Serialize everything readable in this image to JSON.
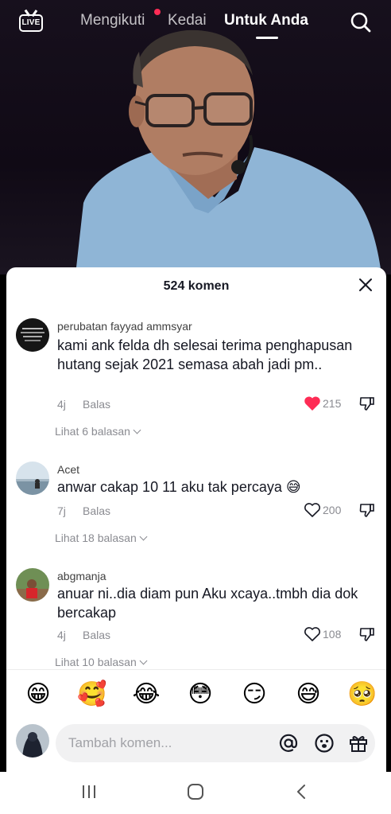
{
  "topnav": {
    "live_label": "LIVE",
    "tabs": [
      {
        "label": "Mengikuti"
      },
      {
        "label": "Kedai"
      },
      {
        "label": "Untuk Anda"
      }
    ]
  },
  "comments_sheet": {
    "title": "524 komen",
    "comments": [
      {
        "username": "perubatan fayyad ammsyar",
        "text": "kami ank felda dh selesai terima penghapusan hutang sejak 2021 semasa abah jadi pm..",
        "time": "4j",
        "reply_label": "Balas",
        "likes": "215",
        "liked": true,
        "view_replies": "Lihat 6 balasan"
      },
      {
        "username": "Acet",
        "text": "anwar cakap 10 11 aku tak percaya 😅",
        "time": "7j",
        "reply_label": "Balas",
        "likes": "200",
        "liked": false,
        "view_replies": "Lihat 18 balasan"
      },
      {
        "username": "abgmanja",
        "text": "anuar ni..dia diam pun Aku xcaya..tmbh dia dok bercakap",
        "time": "4j",
        "reply_label": "Balas",
        "likes": "108",
        "liked": false,
        "view_replies": "Lihat 10 balasan"
      }
    ],
    "emoji_bar": [
      "😁",
      "🥰",
      "😂",
      "😳",
      "😏",
      "😅",
      "🥺"
    ],
    "composer": {
      "placeholder": "Tambah komen...",
      "icons": [
        "at-icon",
        "emoji-icon",
        "gift-icon"
      ]
    }
  },
  "colors": {
    "accent_red": "#fe2c55",
    "text_primary": "#161823",
    "text_secondary": "#8a8b91"
  }
}
